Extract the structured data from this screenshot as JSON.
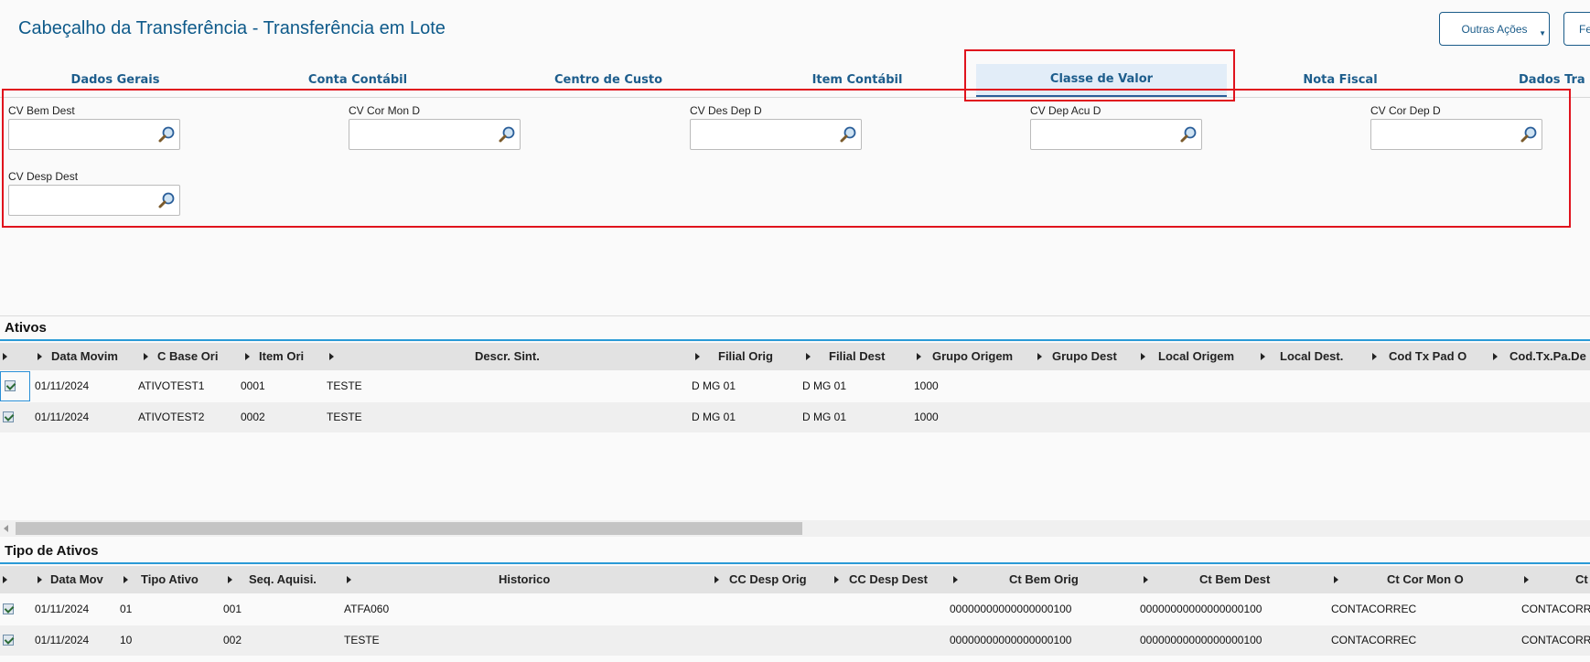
{
  "header": {
    "title": "Cabeçalho da Transferência - Transferência em Lote",
    "outras_acoes": "Outras Ações",
    "fechar": "Fe"
  },
  "tabs": [
    "Dados Gerais",
    "Conta Contábil",
    "Centro de Custo",
    "Item Contábil",
    "Classe de Valor",
    "Nota Fiscal",
    "Dados Tra"
  ],
  "active_tab": "Classe de Valor",
  "form": {
    "fields": [
      "CV Bem Dest",
      "CV Cor Mon D",
      "CV Des Dep D",
      "CV Dep Acu D",
      "CV Cor Dep D",
      "CV Desp Dest"
    ]
  },
  "ativos": {
    "title": "Ativos",
    "columns": [
      "Data Movim",
      "C Base Ori",
      "Item Ori",
      "Descr. Sint.",
      "Filial Orig",
      "Filial Dest",
      "Grupo Origem",
      "Grupo Dest",
      "Local Origem",
      "Local Dest.",
      "Cod Tx Pad O",
      "Cod.Tx.Pa.De"
    ],
    "rows": [
      [
        "01/11/2024",
        "ATIVOTEST1",
        "0001",
        "TESTE",
        "D MG 01",
        "D MG 01",
        "1000"
      ],
      [
        "01/11/2024",
        "ATIVOTEST2",
        "0002",
        "TESTE",
        "D MG 01",
        "D MG 01",
        "1000"
      ]
    ]
  },
  "tipo_ativos": {
    "title": "Tipo de Ativos",
    "columns": [
      "Data Mov",
      "Tipo Ativo",
      "Seq. Aquisi.",
      "Historico",
      "CC Desp Orig",
      "CC Desp Dest",
      "Ct Bem Orig",
      "Ct Bem Dest",
      "Ct Cor Mon O",
      "Ct"
    ],
    "rows": [
      [
        "01/11/2024",
        "01",
        "001",
        "ATFA060",
        "00000000000000000100",
        "00000000000000000100",
        "CONTACORREC",
        "CONTACORR"
      ],
      [
        "01/11/2024",
        "10",
        "002",
        "TESTE",
        "00000000000000000100",
        "00000000000000000100",
        "CONTACORREC",
        "CONTACORR"
      ]
    ]
  },
  "colors": {
    "accent": "#1d5d8c",
    "highlight": "#e0131d",
    "grid_line": "#2a9ad6"
  }
}
